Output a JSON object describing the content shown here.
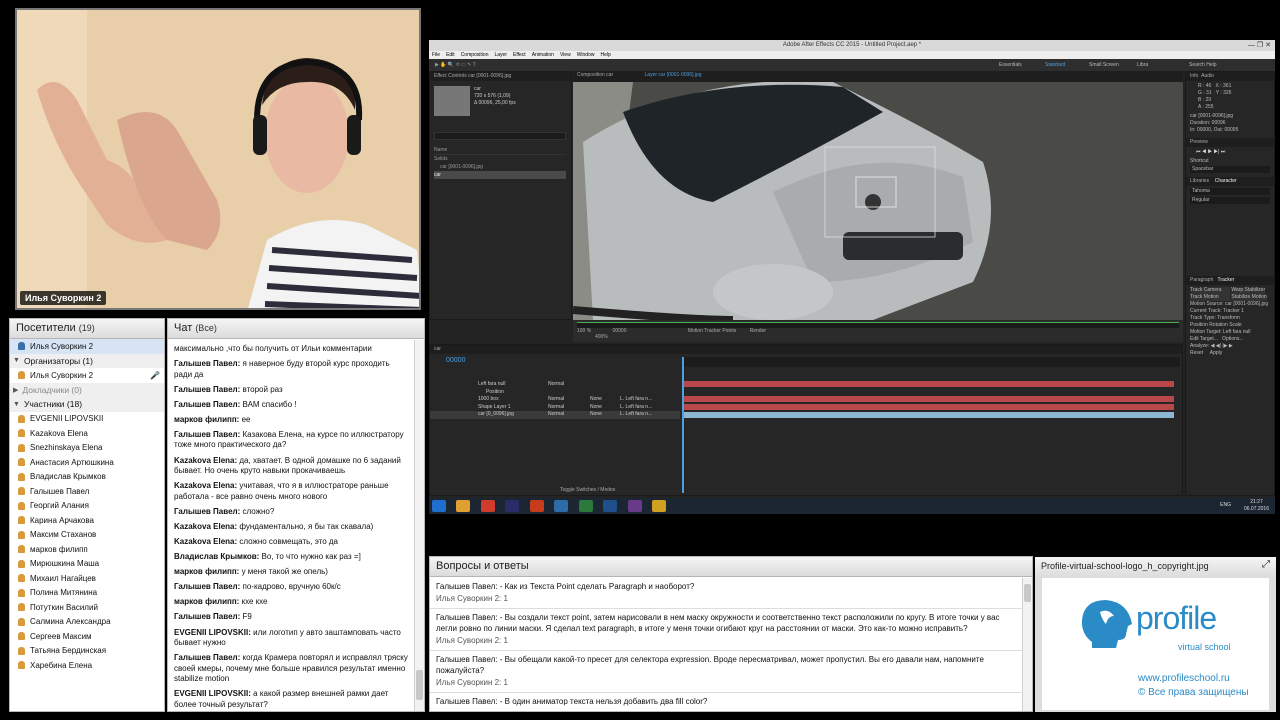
{
  "webcam": {
    "name": "Илья Суворкин 2"
  },
  "visitors": {
    "title": "Посетители",
    "count": "(19)",
    "top_user": "Илья Суворкин 2",
    "organizers_label": "Организаторы (1)",
    "organizer": "Илья Суворкин 2",
    "speakers_label": "Докладчики (0)",
    "participants_label": "Участники (18)",
    "participants": [
      "EVGENII LIPOVSKII",
      "Kazakova Elena",
      "Snezhinskaya Elena",
      "Анастасия Артюшкина",
      "Владислав Крымков",
      "Галышев Павел",
      "Георгий Алания",
      "Карина Арчакова",
      "Максим Стаханов",
      "марков филипп",
      "Мирюшкина Маша",
      "Михаил Нагайцев",
      "Полина Митянина",
      "Потуткин Василий",
      "Салмина Александра",
      "Сергеев Максим",
      "Татьяна Бердинская",
      "Харебина Елена"
    ]
  },
  "chat": {
    "title": "Чат",
    "scope": "(Все)",
    "messages": [
      {
        "author": "",
        "text": "максимально ,что бы получить от Ильи комментарии"
      },
      {
        "author": "Галышев Павел:",
        "text": "я наверное буду второй курс проходить ради да"
      },
      {
        "author": "Галышев Павел:",
        "text": "второй раз"
      },
      {
        "author": "Галышев Павел:",
        "text": "ВАМ спасибо !"
      },
      {
        "author": "марков филипп:",
        "text": "ее"
      },
      {
        "author": "Галышев Павел:",
        "text": "Казакова Елена, на курсе по иллюстратору тоже много практического да?"
      },
      {
        "author": "Kazakova Elena:",
        "text": "да, хватает. В одной домашке по 6 заданий бывает. Но очень круто навыки прокачиваешь"
      },
      {
        "author": "Kazakova Elena:",
        "text": "учитавая, что я в иллюстраторе раньше работала - все равно очень много нового"
      },
      {
        "author": "Галышев Павел:",
        "text": "сложно?"
      },
      {
        "author": "Kazakova Elena:",
        "text": "фундаментально, я бы так скавала)"
      },
      {
        "author": "Kazakova Elena:",
        "text": "сложно совмещать, это да"
      },
      {
        "author": "Владислав Крымков:",
        "text": "Во, то что нужно как раз =]"
      },
      {
        "author": "марков филипп:",
        "text": "у меня такой же опель)"
      },
      {
        "author": "Галышев Павел:",
        "text": "по-кадрово, вручную 60к/с"
      },
      {
        "author": "марков филипп:",
        "text": "кхе кхе"
      },
      {
        "author": "Галышев Павел:",
        "text": "F9"
      },
      {
        "author": "EVGENII LIPOVSKII:",
        "text": "или логотип у авто заштамповать часто бывает нужно"
      },
      {
        "author": "Галышев Павел:",
        "text": "когда Крамера повторял и исправлял тряску своей кмеры, почему мне больше нравился результат именно stabilize motion"
      },
      {
        "author": "EVGENII LIPOVSKII:",
        "text": "а какой размер внешней рамки дает более точный результат?"
      }
    ]
  },
  "ae": {
    "title": "Adobe After Effects CC 2015 - Untitled Project.aep *",
    "menu": [
      "File",
      "Edit",
      "Composition",
      "Layer",
      "Effect",
      "Animation",
      "View",
      "Window",
      "Help"
    ],
    "workspaces": [
      "Essentials",
      "Standard",
      "Small Screen",
      "Libra"
    ],
    "search": "Search Help",
    "tabs": {
      "effect": "Effect Controls car [0001-0096].jpg",
      "comp": "Composition car",
      "layer": "Layer car [0001-0096].jpg"
    },
    "project": {
      "item": "car",
      "info1": "720 x 576 (1,09)",
      "info2": "Δ 00096, 25,00 fps",
      "col_name": "Name",
      "rows": [
        "Solids",
        "car [0001-0096].jpg",
        "car"
      ]
    },
    "viewer": {
      "zoom": "400%",
      "timecode": "00000",
      "view": "Motion Tracker Points",
      "render": "Render",
      "scale": "100 %"
    },
    "timeline": {
      "comp": "car",
      "time": "00000",
      "layers": [
        "Left fara null",
        "Position",
        "1000 box",
        "Shape Layer 1",
        "car [0_0096].jpg"
      ],
      "modes": "Normal",
      "parent": "None",
      "parent_vals": [
        "L. Left fara n...",
        "L. Left fara n...",
        "L. Left fara n..."
      ],
      "toggle": "Toggle Switches / Modes"
    },
    "right": {
      "info": "Info",
      "audio": "Audio",
      "info_vals": [
        "R : 46",
        "G : 31",
        "B : 29",
        "A : 255",
        "X : 361",
        "Y : 326"
      ],
      "file": "car [0001-0096].jpg",
      "duration": "Duration: 00096",
      "inout": "In: 00000, Out: 00095",
      "preview": "Preview",
      "shortcut": "Shortcut",
      "spacebar": "Spacebar",
      "libraries": "Libraries",
      "character": "Character",
      "font": "Tahoma",
      "style": "Regular",
      "tracker": "Tracker",
      "paragraph": "Paragraph",
      "track_camera": "Track Camera",
      "warp": "Warp Stabilizer",
      "track_motion": "Track Motion",
      "stab_motion": "Stabilize Motion",
      "source_label": "Motion Source:",
      "source": "car [0001-0096].jpg",
      "current_label": "Current Track:",
      "current": "Tracker 1",
      "type_label": "Track Type:",
      "type": "Transform",
      "position": "Position",
      "rotation": "Rotation",
      "scale": "Scale",
      "target": "Motion Target: Left fara null",
      "edit_target": "Edit Target...",
      "options": "Options...",
      "analyze": "Analyze:",
      "reset": "Reset",
      "apply": "Apply"
    },
    "clock": {
      "time": "21:27",
      "date": "06.07.2016",
      "lang": "ENG"
    }
  },
  "qa": {
    "title": "Вопросы и ответы",
    "items": [
      {
        "q": "Галышев Павел: - Как из Текста Point сделать Paragraph и наоборот?",
        "a": "Илья Суворкин 2: 1"
      },
      {
        "q": "Галышев Павел: - Вы создали текст point, затем нарисовали в нем маску окружности и соответственно текст расположили по кругу. В итоге точки у вас легли ровно по линии маски. Я сделал text paragraph, в итоге у меня точки огибают круг на расстоянии от маски. Это как-то можно исправить?",
        "a": "Илья Суворкин 2: 1"
      },
      {
        "q": "Галышев Павел: - Вы обещали какой-то пресет для селектора expression. Вроде пересматривал, может пропустил. Вы его давали нам, напомните пожалуйста?",
        "a": "Илья Суворкин 2: 1"
      },
      {
        "q": "Галышев Павел: - В один аниматор текста нельзя добавить два fill color?",
        "a": ""
      }
    ]
  },
  "logo": {
    "title": "Profile-virtual-school-logo_h_copyright.jpg",
    "brand": "profile",
    "sub": "virtual school",
    "url": "www.profileschool.ru",
    "copy": "© Все права защищены",
    "accent": "#2a8bc7"
  }
}
